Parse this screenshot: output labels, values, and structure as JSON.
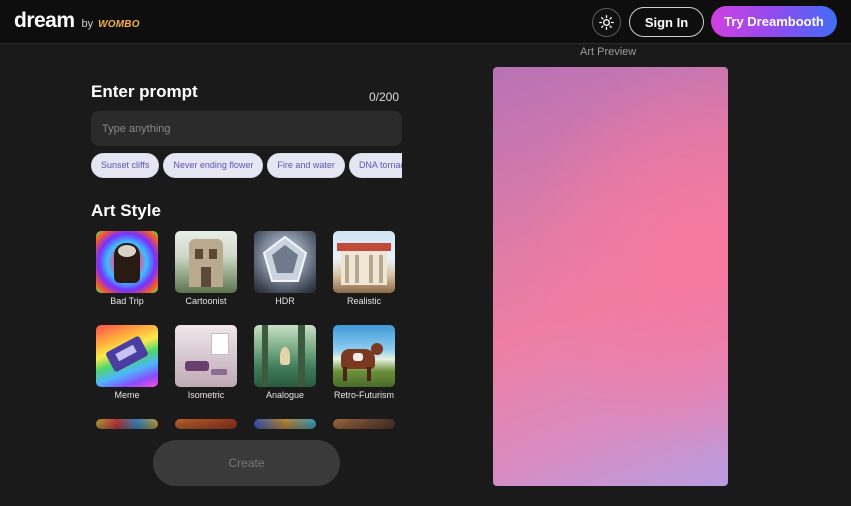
{
  "header": {
    "brand_name": "dream",
    "brand_by": "by",
    "brand_logo": "WOMBO",
    "sign_in_label": "Sign In",
    "dreambooth_label": "Try Dreambooth",
    "theme_icon": "sun-icon"
  },
  "prompt": {
    "title": "Enter prompt",
    "counter": "0/200",
    "placeholder": "Type anything",
    "suggestions": [
      "Sunset cliffs",
      "Never ending flower",
      "Fire and water",
      "DNA tornado"
    ]
  },
  "art_style": {
    "title": "Art Style",
    "styles": [
      {
        "label": "Bad Trip"
      },
      {
        "label": "Cartoonist"
      },
      {
        "label": "HDR"
      },
      {
        "label": "Realistic"
      },
      {
        "label": "Meme"
      },
      {
        "label": "Isometric"
      },
      {
        "label": "Analogue"
      },
      {
        "label": "Retro-Futurism"
      }
    ]
  },
  "create_label": "Create",
  "preview": {
    "label": "Art Preview"
  },
  "colors": {
    "background": "#1a1a1a",
    "header": "#0e0e0e",
    "chip_bg": "#e6e6f2",
    "chip_text": "#5b57b5",
    "dreambooth_gradient": [
      "#d13fe0",
      "#3f6df5"
    ]
  }
}
